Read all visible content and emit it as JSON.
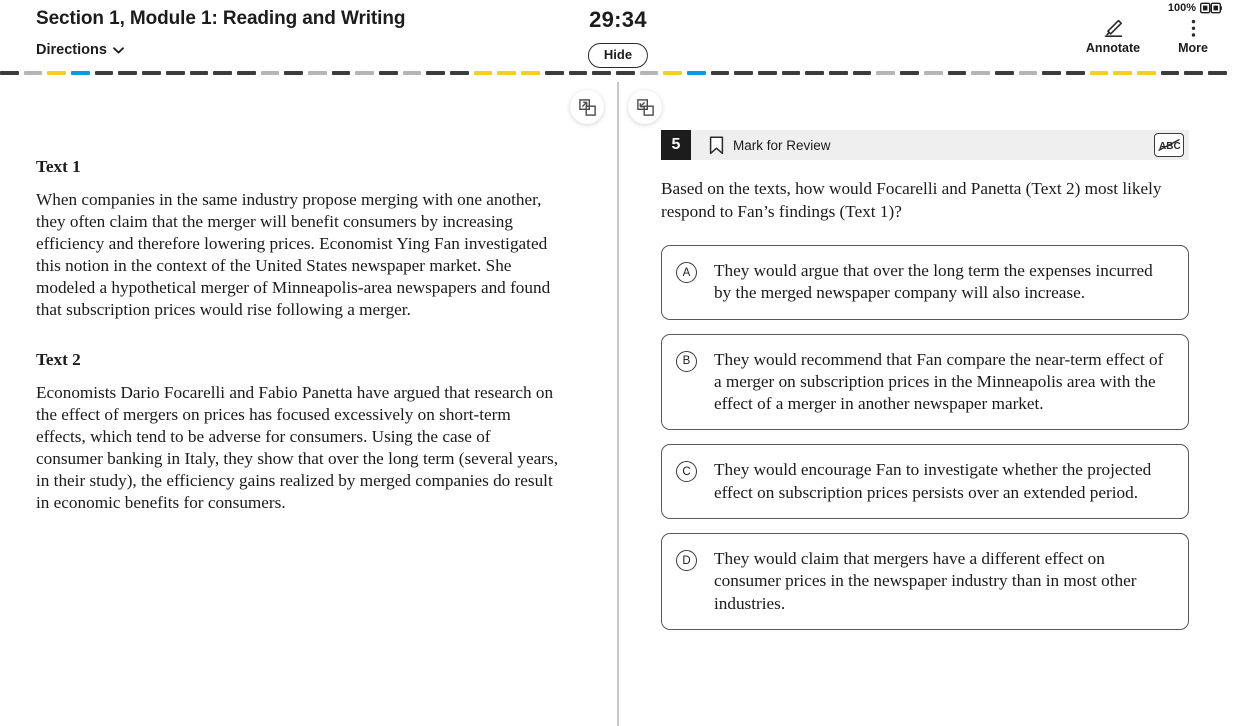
{
  "header": {
    "section_title": "Section 1, Module 1: Reading and Writing",
    "directions_label": "Directions",
    "timer": "29:34",
    "hide_label": "Hide",
    "battery_percent": "100%",
    "annotate_label": "Annotate",
    "more_label": "More"
  },
  "progress": {
    "colors": {
      "dark": "#3c3c3c",
      "light": "#b5b5b5",
      "yellow": "#f5d020",
      "blue": "#00a0df"
    },
    "segments": [
      "dark",
      "light",
      "yellow",
      "blue",
      "dark",
      "dark",
      "dark",
      "dark",
      "dark",
      "dark",
      "dark",
      "light",
      "dark",
      "light",
      "dark",
      "light",
      "dark",
      "light",
      "dark",
      "dark",
      "yellow",
      "yellow",
      "yellow",
      "dark",
      "dark",
      "dark",
      "dark",
      "light",
      "yellow",
      "blue",
      "dark",
      "dark",
      "dark",
      "dark",
      "dark",
      "dark",
      "dark",
      "light",
      "dark",
      "light",
      "dark",
      "light",
      "dark",
      "light",
      "dark",
      "dark",
      "yellow",
      "yellow",
      "yellow",
      "dark",
      "dark",
      "dark"
    ]
  },
  "panes": {
    "collapse_left_label": "collapse-left-pane",
    "expand_right_label": "expand-right-pane"
  },
  "passage": {
    "text1_heading": "Text 1",
    "text1_body": "When companies in the same industry propose merging with one another, they often claim that the merger will benefit consumers by increasing efficiency and therefore lowering prices. Economist Ying Fan investigated this notion in the context of the United States newspaper market. She modeled a hypothetical merger of Minneapolis-area newspapers and found that subscription prices would rise following a merger.",
    "text2_heading": "Text 2",
    "text2_body": "Economists Dario Focarelli and Fabio Panetta have argued that research on the effect of mergers on prices has focused excessively on short-term effects, which tend to be adverse for consumers. Using the case of consumer banking in Italy, they show that over the long term (several years, in their study), the efficiency gains realized by merged companies do result in economic benefits for consumers."
  },
  "question": {
    "number": "5",
    "mark_for_review_label": "Mark for Review",
    "cross_out_label": "ABC",
    "prompt": "Based on the texts, how would Focarelli and Panetta (Text 2) most likely respond to Fan’s findings (Text 1)?",
    "choices": [
      {
        "letter": "A",
        "text": "They would argue that over the long term the expenses incurred by the merged newspaper company will also increase."
      },
      {
        "letter": "B",
        "text": "They would recommend that Fan compare the near-term effect of a merger on subscription prices in the Minneapolis area with the effect of a merger in another newspaper market."
      },
      {
        "letter": "C",
        "text": "They would encourage Fan to investigate whether the projected effect on subscription prices persists over an extended period."
      },
      {
        "letter": "D",
        "text": "They would claim that mergers have a different effect on consumer prices in the newspaper industry than in most other industries."
      }
    ]
  }
}
